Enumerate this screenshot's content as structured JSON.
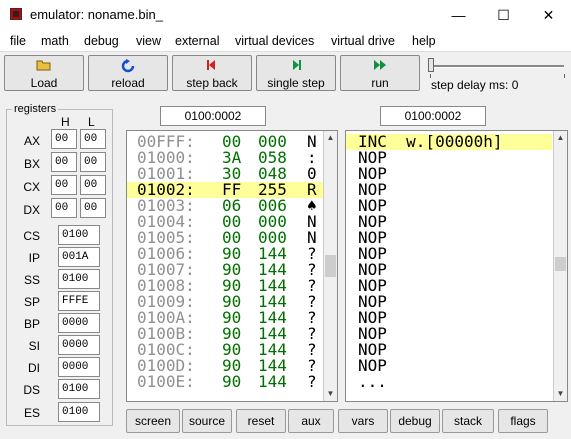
{
  "window": {
    "title": "emulator: noname.bin_",
    "minimize": "—",
    "maximize": "☐",
    "close": "✕"
  },
  "menu": [
    "file",
    "math",
    "debug",
    "view",
    "external",
    "virtual devices",
    "virtual drive",
    "help"
  ],
  "toolbar": {
    "load": {
      "label": "Load",
      "icon": "folder-icon"
    },
    "reload": {
      "label": "reload",
      "icon": "reload-icon"
    },
    "step_back": {
      "label": "step back",
      "icon": "step-back-icon"
    },
    "single_step": {
      "label": "single step",
      "icon": "single-step-icon"
    },
    "run": {
      "label": "run",
      "icon": "run-icon"
    },
    "step_delay": {
      "label": "step delay ms: 0",
      "value": 0
    }
  },
  "registers": {
    "title": "registers",
    "h": "H",
    "l": "L",
    "pairs": [
      {
        "name": "AX",
        "h": "00",
        "l": "00"
      },
      {
        "name": "BX",
        "h": "00",
        "l": "00"
      },
      {
        "name": "CX",
        "h": "00",
        "l": "00"
      },
      {
        "name": "DX",
        "h": "00",
        "l": "00"
      }
    ],
    "single": [
      {
        "name": "CS",
        "value": "0100"
      },
      {
        "name": "IP",
        "value": "001A"
      },
      {
        "name": "SS",
        "value": "0100"
      },
      {
        "name": "SP",
        "value": "FFFE"
      },
      {
        "name": "BP",
        "value": "0000"
      },
      {
        "name": "SI",
        "value": "0000"
      },
      {
        "name": "DI",
        "value": "0000"
      },
      {
        "name": "DS",
        "value": "0100"
      },
      {
        "name": "ES",
        "value": "0100"
      }
    ]
  },
  "memory": {
    "address": "0100:0002",
    "rows": [
      {
        "addr": "00FFF:",
        "hex": "00",
        "dec": "000",
        "chr": "N"
      },
      {
        "addr": "01000:",
        "hex": "3A",
        "dec": "058",
        "chr": ":"
      },
      {
        "addr": "01001:",
        "hex": "30",
        "dec": "048",
        "chr": "0"
      },
      {
        "addr": "01002:",
        "hex": "FF",
        "dec": "255",
        "chr": "R"
      },
      {
        "addr": "01003:",
        "hex": "06",
        "dec": "006",
        "chr": "♠"
      },
      {
        "addr": "01004:",
        "hex": "00",
        "dec": "000",
        "chr": "N"
      },
      {
        "addr": "01005:",
        "hex": "00",
        "dec": "000",
        "chr": "N"
      },
      {
        "addr": "01006:",
        "hex": "90",
        "dec": "144",
        "chr": "?"
      },
      {
        "addr": "01007:",
        "hex": "90",
        "dec": "144",
        "chr": "?"
      },
      {
        "addr": "01008:",
        "hex": "90",
        "dec": "144",
        "chr": "?"
      },
      {
        "addr": "01009:",
        "hex": "90",
        "dec": "144",
        "chr": "?"
      },
      {
        "addr": "0100A:",
        "hex": "90",
        "dec": "144",
        "chr": "?"
      },
      {
        "addr": "0100B:",
        "hex": "90",
        "dec": "144",
        "chr": "?"
      },
      {
        "addr": "0100C:",
        "hex": "90",
        "dec": "144",
        "chr": "?"
      },
      {
        "addr": "0100D:",
        "hex": "90",
        "dec": "144",
        "chr": "?"
      },
      {
        "addr": "0100E:",
        "hex": "90",
        "dec": "144",
        "chr": "?"
      }
    ],
    "selected_index": 3
  },
  "disassembly": {
    "address": "0100:0002",
    "lines": [
      "INC  w.[00000h]",
      "NOP",
      "NOP",
      "NOP",
      "NOP",
      "NOP",
      "NOP",
      "NOP",
      "NOP",
      "NOP",
      "NOP",
      "NOP",
      "NOP",
      "NOP",
      "NOP",
      "..."
    ],
    "selected_index": 0
  },
  "bottom_buttons": [
    "screen",
    "source",
    "reset",
    "aux",
    "vars",
    "debug",
    "stack",
    "flags"
  ],
  "colors": {
    "highlight": "#ffff99",
    "hex_green": "#007000",
    "gray_text": "#909090",
    "dark_text": "#000000"
  }
}
